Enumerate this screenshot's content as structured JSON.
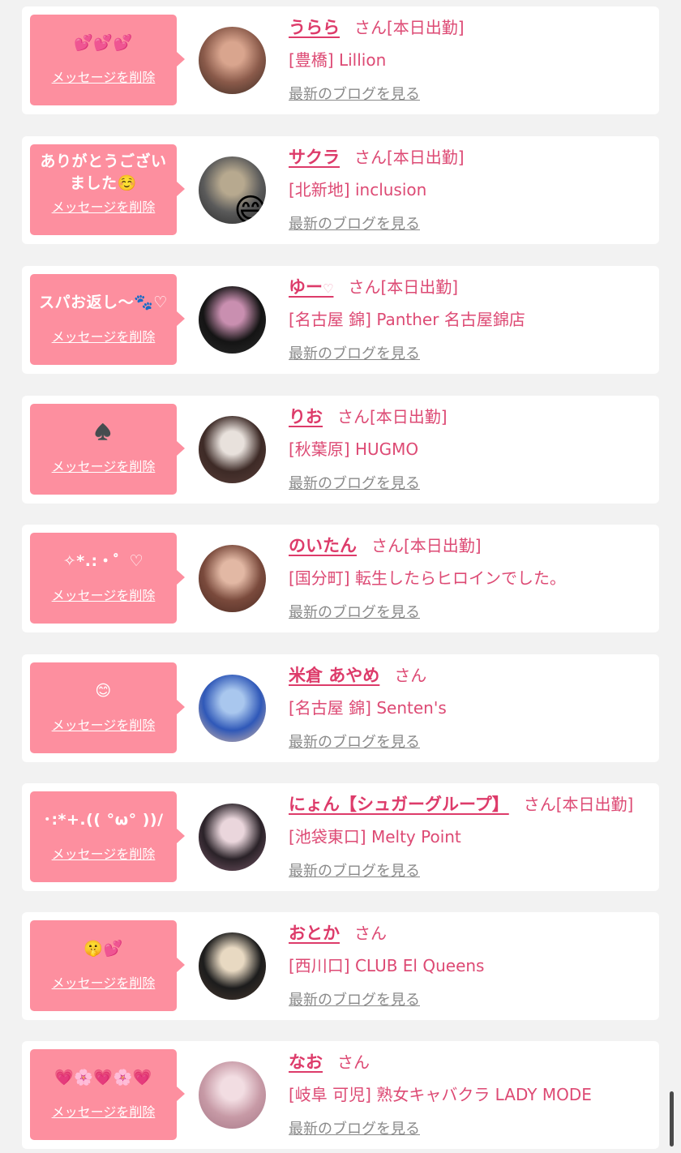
{
  "colors": {
    "background": "#f2f2f2",
    "card": "#ffffff",
    "bubble": "#fd8f9f",
    "name": "#dd3b6a",
    "shop_text": "#dd4a74",
    "blog_link": "#8a8a8a"
  },
  "delete_label": "メッセージを削除",
  "blog_label": "最新のブログを見る",
  "honorific": "さん",
  "items": [
    {
      "message": "💕💕💕",
      "name": "うらら",
      "name_suffix": "",
      "status": "[本日出勤]",
      "shop": "[豊橋] Lillion",
      "avatar_colors": [
        "#8a5a4a",
        "#d9a58e",
        "#3a2a22"
      ]
    },
    {
      "message": "ありがとうございました☺️",
      "name": "サクラ",
      "name_suffix": "",
      "status": "[本日出勤]",
      "shop": "[北新地] inclusion",
      "avatar_colors": [
        "#5a5a5a",
        "#b7a98f",
        "#2a2a2a"
      ],
      "avatar_emoji": "😄"
    },
    {
      "message": "スパお返し〜🐾♡",
      "name": "ゆー",
      "name_suffix": "♡",
      "status": "[本日出勤]",
      "shop": "[名古屋 錦] Panther 名古屋錦店",
      "avatar_colors": [
        "#141414",
        "#c98fb0",
        "#2c2c2c"
      ]
    },
    {
      "message": "♠️",
      "name": "りお",
      "name_suffix": "",
      "status": "[本日出勤]",
      "shop": "[秋葉原] HUGMO",
      "avatar_colors": [
        "#3d2a26",
        "#e8e1dc",
        "#5a3f3a"
      ]
    },
    {
      "message": "✧*.:・゜♡",
      "name": "のいたん",
      "name_suffix": "",
      "status": "[本日出勤]",
      "shop": "[国分町] 転生したらヒロインでした。",
      "avatar_colors": [
        "#7a4a3c",
        "#e2b8a4",
        "#4a2a22"
      ]
    },
    {
      "message": "😊",
      "name": "米倉 あやめ",
      "name_suffix": "",
      "status": "",
      "shop": "[名古屋 錦] Senten's",
      "avatar_colors": [
        "#2f58b8",
        "#a9c7ee",
        "#e3c0a8"
      ]
    },
    {
      "message": "･:*+.(( °ω° ))/",
      "name": "にょん【シュガーグループ】",
      "name_suffix": "",
      "status": "[本日出勤]",
      "shop": "[池袋東口] Melty Point",
      "avatar_colors": [
        "#2a2228",
        "#ead6dc",
        "#7a5a6a"
      ]
    },
    {
      "message": "🤫💕",
      "name": "おとか",
      "name_suffix": "",
      "status": "",
      "shop": "[西川口] CLUB El Queens",
      "avatar_colors": [
        "#1c1c1c",
        "#e8d9c2",
        "#4a3a30"
      ]
    },
    {
      "message": "💗🌸💗🌸💗",
      "name": "なお",
      "name_suffix": "",
      "status": "",
      "shop": "[岐阜 可児] 熟女キャバクラ LADY MODE",
      "avatar_colors": [
        "#c79aa6",
        "#f2dde2",
        "#a57686"
      ]
    }
  ]
}
